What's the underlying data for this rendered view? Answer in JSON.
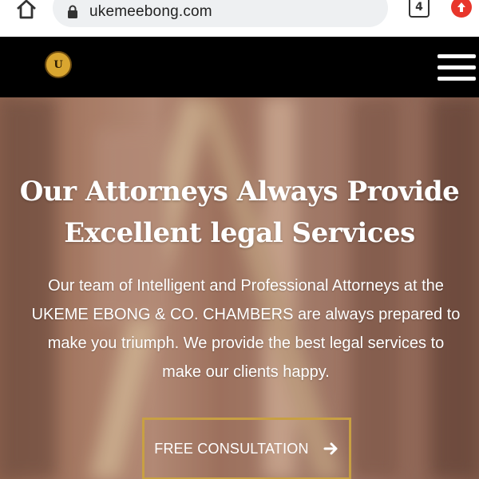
{
  "browser": {
    "url": "ukemeebong.com",
    "tab_count": "4",
    "icons": {
      "home": "home-icon",
      "lock": "lock-icon",
      "update": "update-arrow-icon"
    }
  },
  "header": {
    "logo_letter": "U",
    "menu_icon": "hamburger-menu-icon"
  },
  "hero": {
    "title_line1": "Our Attorneys Always Provide",
    "title_line2": "Excellent legal Services",
    "text_line1": "Our team of Intelligent and Professional Attorneys at the",
    "text_line2": "UKEME EBONG & CO. CHAMBERS are always prepared to",
    "text_line3": "make you triumph. We provide the best legal services to",
    "text_line4": "make our clients happy.",
    "cta_label": "FREE CONSULTATION"
  },
  "colors": {
    "header_bg": "#000000",
    "accent_gold": "#c8a042",
    "update_red": "#e8362b"
  }
}
